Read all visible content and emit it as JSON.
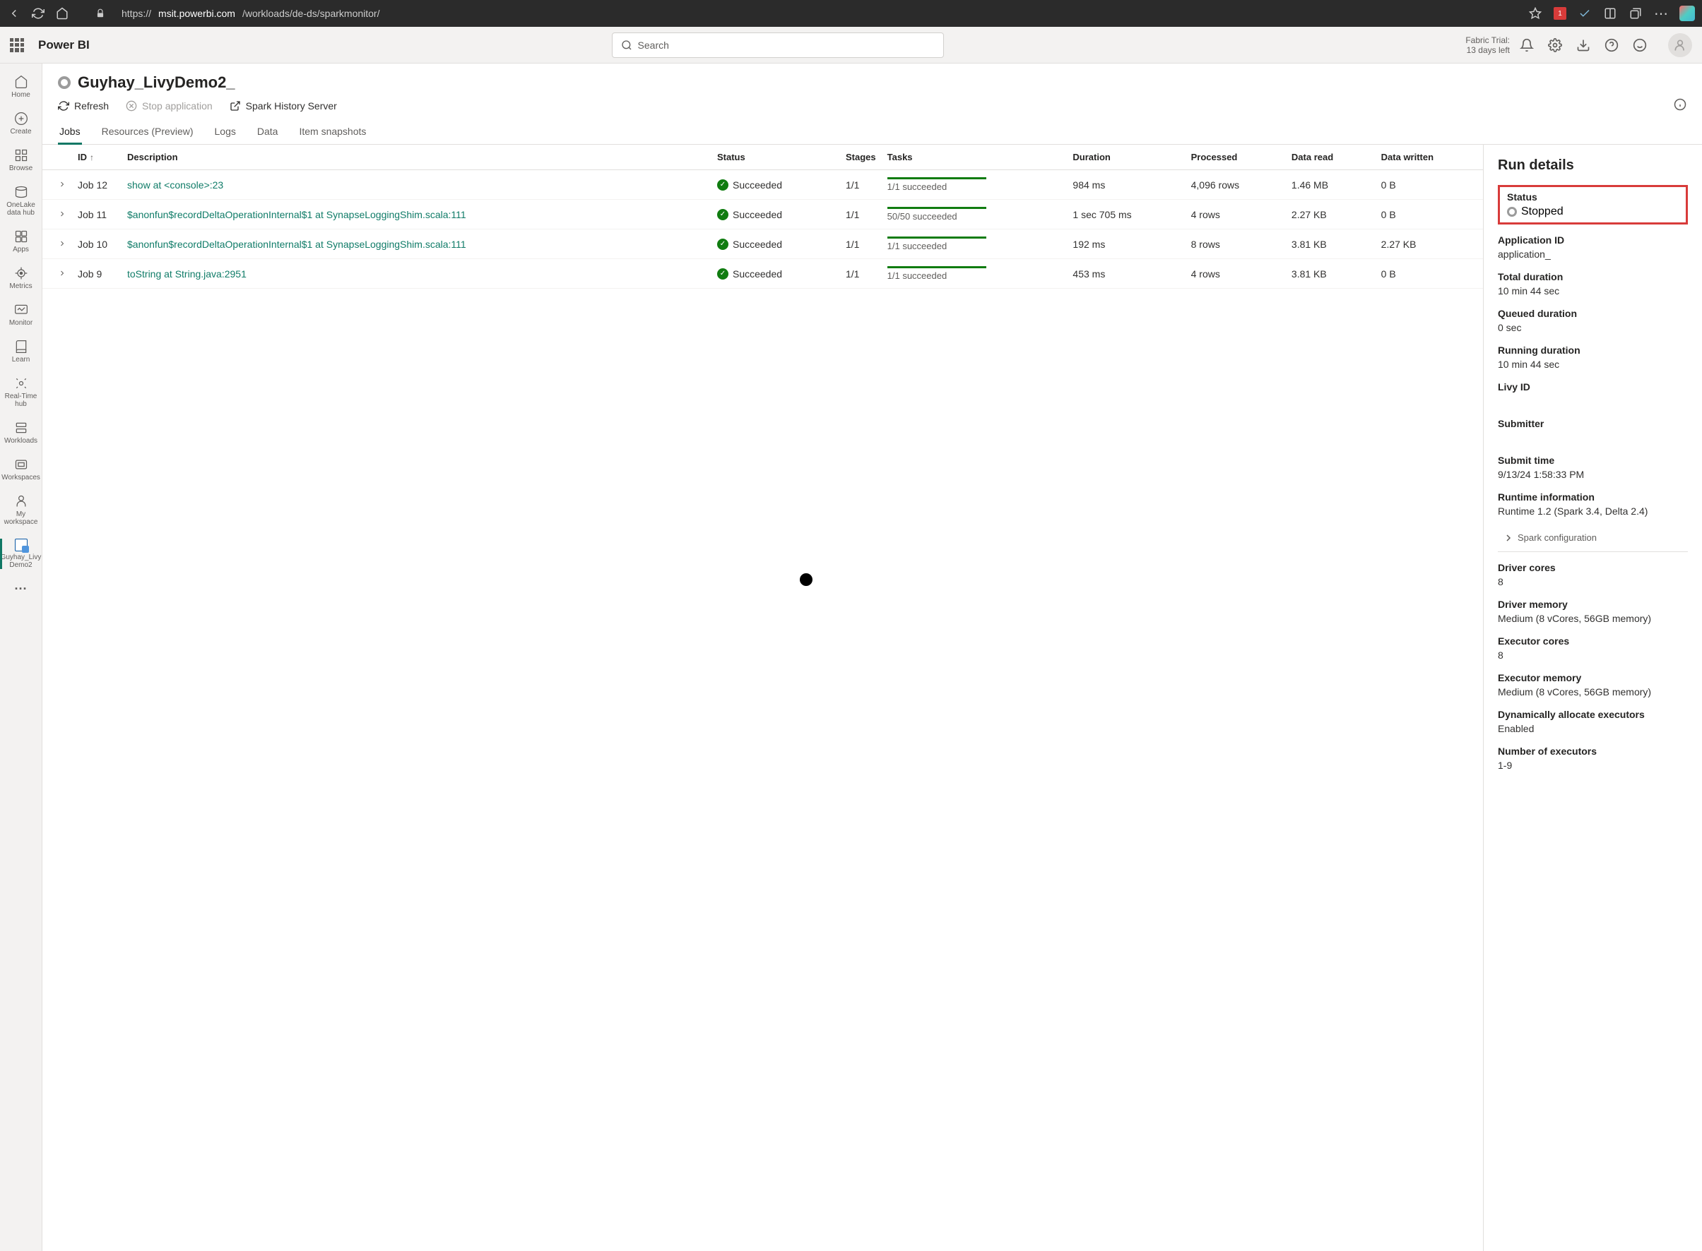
{
  "browser": {
    "url_prefix": "https://",
    "url_domain": "msit.powerbi.com",
    "url_path": "/workloads/de-ds/sparkmonitor/",
    "badge": "1"
  },
  "header": {
    "brand": "Power BI",
    "search_placeholder": "Search",
    "trial_line1": "Fabric Trial:",
    "trial_line2": "13 days left"
  },
  "nav": {
    "home": "Home",
    "create": "Create",
    "browse": "Browse",
    "onelake": "OneLake data hub",
    "apps": "Apps",
    "metrics": "Metrics",
    "monitor": "Monitor",
    "learn": "Learn",
    "realtime": "Real-Time hub",
    "workloads": "Workloads",
    "workspaces": "Workspaces",
    "myworkspace": "My workspace",
    "current": "Guyhay_Livy Demo2",
    "more": "···"
  },
  "page": {
    "title": "Guyhay_LivyDemo2_",
    "refresh": "Refresh",
    "stop": "Stop application",
    "history": "Spark History Server"
  },
  "tabs": {
    "jobs": "Jobs",
    "resources": "Resources (Preview)",
    "logs": "Logs",
    "data": "Data",
    "snapshots": "Item snapshots"
  },
  "columns": {
    "id": "ID",
    "description": "Description",
    "status": "Status",
    "stages": "Stages",
    "tasks": "Tasks",
    "duration": "Duration",
    "processed": "Processed",
    "dataread": "Data read",
    "datawritten": "Data written"
  },
  "rows": [
    {
      "id": "Job 12",
      "desc": "show at <console>:23",
      "status": "Succeeded",
      "stages": "1/1",
      "tasks": "1/1 succeeded",
      "duration": "984 ms",
      "processed": "4,096 rows",
      "read": "1.46 MB",
      "written": "0 B"
    },
    {
      "id": "Job 11",
      "desc": "$anonfun$recordDeltaOperationInternal$1 at SynapseLoggingShim.scala:111",
      "status": "Succeeded",
      "stages": "1/1",
      "tasks": "50/50 succeeded",
      "duration": "1 sec 705 ms",
      "processed": "4 rows",
      "read": "2.27 KB",
      "written": "0 B"
    },
    {
      "id": "Job 10",
      "desc": "$anonfun$recordDeltaOperationInternal$1 at SynapseLoggingShim.scala:111",
      "status": "Succeeded",
      "stages": "1/1",
      "tasks": "1/1 succeeded",
      "duration": "192 ms",
      "processed": "8 rows",
      "read": "3.81 KB",
      "written": "2.27 KB"
    },
    {
      "id": "Job 9",
      "desc": "toString at String.java:2951",
      "status": "Succeeded",
      "stages": "1/1",
      "tasks": "1/1 succeeded",
      "duration": "453 ms",
      "processed": "4 rows",
      "read": "3.81 KB",
      "written": "0 B"
    }
  ],
  "details": {
    "title": "Run details",
    "status_label": "Status",
    "status_value": "Stopped",
    "appid_label": "Application ID",
    "appid_value": "application_",
    "totaldur_label": "Total duration",
    "totaldur_value": "10 min 44 sec",
    "queued_label": "Queued duration",
    "queued_value": "0 sec",
    "running_label": "Running duration",
    "running_value": "10 min 44 sec",
    "livy_label": "Livy ID",
    "submitter_label": "Submitter",
    "submittime_label": "Submit time",
    "submittime_value": "9/13/24 1:58:33 PM",
    "runtime_label": "Runtime information",
    "runtime_value": "Runtime 1.2 (Spark 3.4, Delta 2.4)",
    "spark_config": "Spark configuration",
    "drivercores_label": "Driver cores",
    "drivercores_value": "8",
    "drivermem_label": "Driver memory",
    "drivermem_value": "Medium (8 vCores, 56GB memory)",
    "execcores_label": "Executor cores",
    "execcores_value": "8",
    "execmem_label": "Executor memory",
    "execmem_value": "Medium (8 vCores, 56GB memory)",
    "dynalloc_label": "Dynamically allocate executors",
    "dynalloc_value": "Enabled",
    "numexec_label": "Number of executors",
    "numexec_value": "1-9"
  }
}
